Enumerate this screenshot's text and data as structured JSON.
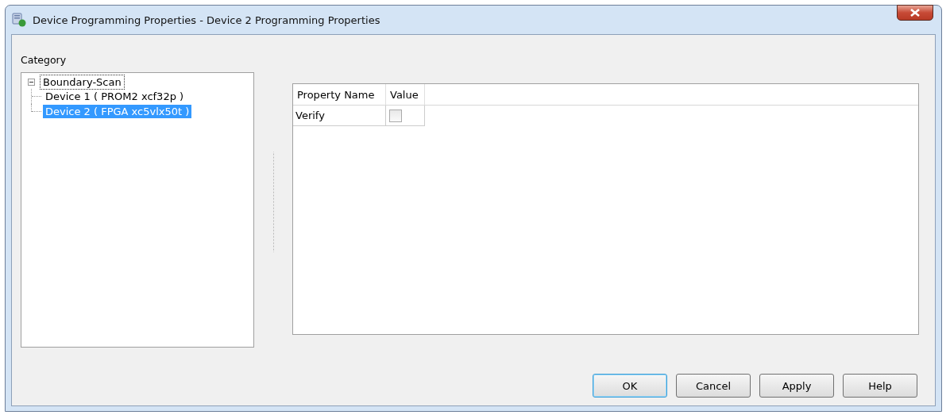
{
  "window": {
    "title": "Device Programming Properties - Device 2 Programming Properties"
  },
  "category_label": "Category",
  "tree": [
    {
      "label": "Boundary-Scan",
      "expanded": true,
      "selected": false,
      "children": [
        {
          "label": "Device 1 ( PROM2 xcf32p )",
          "selected": false
        },
        {
          "label": "Device 2 ( FPGA xc5vlx50t )",
          "selected": true
        }
      ]
    }
  ],
  "table": {
    "columns": [
      "Property Name",
      "Value"
    ],
    "rows": [
      {
        "name": "Verify",
        "checked": false
      }
    ]
  },
  "buttons": [
    {
      "label": "OK",
      "default": true
    },
    {
      "label": "Cancel",
      "default": false
    },
    {
      "label": "Apply",
      "default": false
    },
    {
      "label": "Help",
      "default": false
    }
  ]
}
